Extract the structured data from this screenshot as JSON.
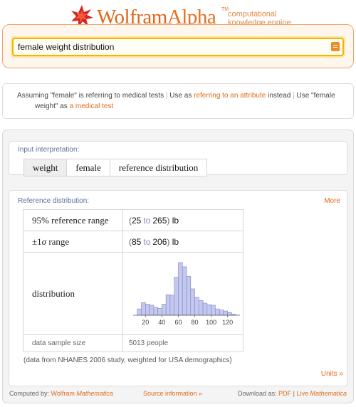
{
  "logo": {
    "brand_a": "Wolfram",
    "brand_b": "Alpha",
    "trademark": "TM",
    "tagline_1": "computational",
    "tagline_2": "knowledge engine"
  },
  "search": {
    "query": "female weight distribution"
  },
  "assumption": {
    "text_1": "Assuming \"female\" is referring to medical tests",
    "sep_1": " | ",
    "text_2": "Use as ",
    "link_attribute": "referring to an attribute",
    "text_3": " instead",
    "sep_2": " | ",
    "text_4": "Use \"female",
    "text_5": "weight\" as ",
    "link_medical": "a medical test"
  },
  "input_interpretation": {
    "title": "Input interpretation:",
    "cells": [
      "weight",
      "female",
      "reference distribution"
    ]
  },
  "reference_pod": {
    "title": "Reference distribution:",
    "more": "More",
    "rows": [
      {
        "label": "95% reference range",
        "open": "(",
        "low": "25",
        "to": "to",
        "high": "265",
        "close": ")",
        "unit": "lb"
      },
      {
        "label_prefix": "±1",
        "label_sigma": "σ",
        "label_suffix": " range",
        "open": "(",
        "low": "85",
        "to": "to",
        "high": "206",
        "close": ")",
        "unit": "lb"
      }
    ],
    "distribution_label": "distribution",
    "sample_label": "data sample size",
    "sample_value": "5013 people",
    "note": "(data from NHANES 2006 study, weighted for USA demographics)",
    "units": "Units »"
  },
  "chart_data": {
    "type": "bar",
    "x_ticks": [
      20,
      40,
      60,
      80,
      100,
      120
    ],
    "xlim": [
      5,
      135
    ],
    "ylim": [
      0,
      100
    ],
    "bin_width": 5,
    "bin_start": 10,
    "values": [
      12,
      24,
      21,
      19,
      15,
      13,
      21,
      39,
      38,
      72,
      100,
      92,
      74,
      50,
      34,
      28,
      23,
      20,
      19,
      12,
      10,
      8,
      5,
      2
    ],
    "bar_color": "#c4c8ee",
    "bar_stroke": "#7f86c8"
  },
  "footer": {
    "computed_by": "Computed by:",
    "wm_1": "Wolfram",
    "wm_2": "Mathematica",
    "source_info": "Source information »",
    "download_as": "Download as:",
    "pdf": "PDF",
    "sep": "|",
    "live_1": "Live",
    "live_2": "Mathematica"
  },
  "colors": {
    "accent": "#e06a1a",
    "pod_title": "#5b7399"
  }
}
